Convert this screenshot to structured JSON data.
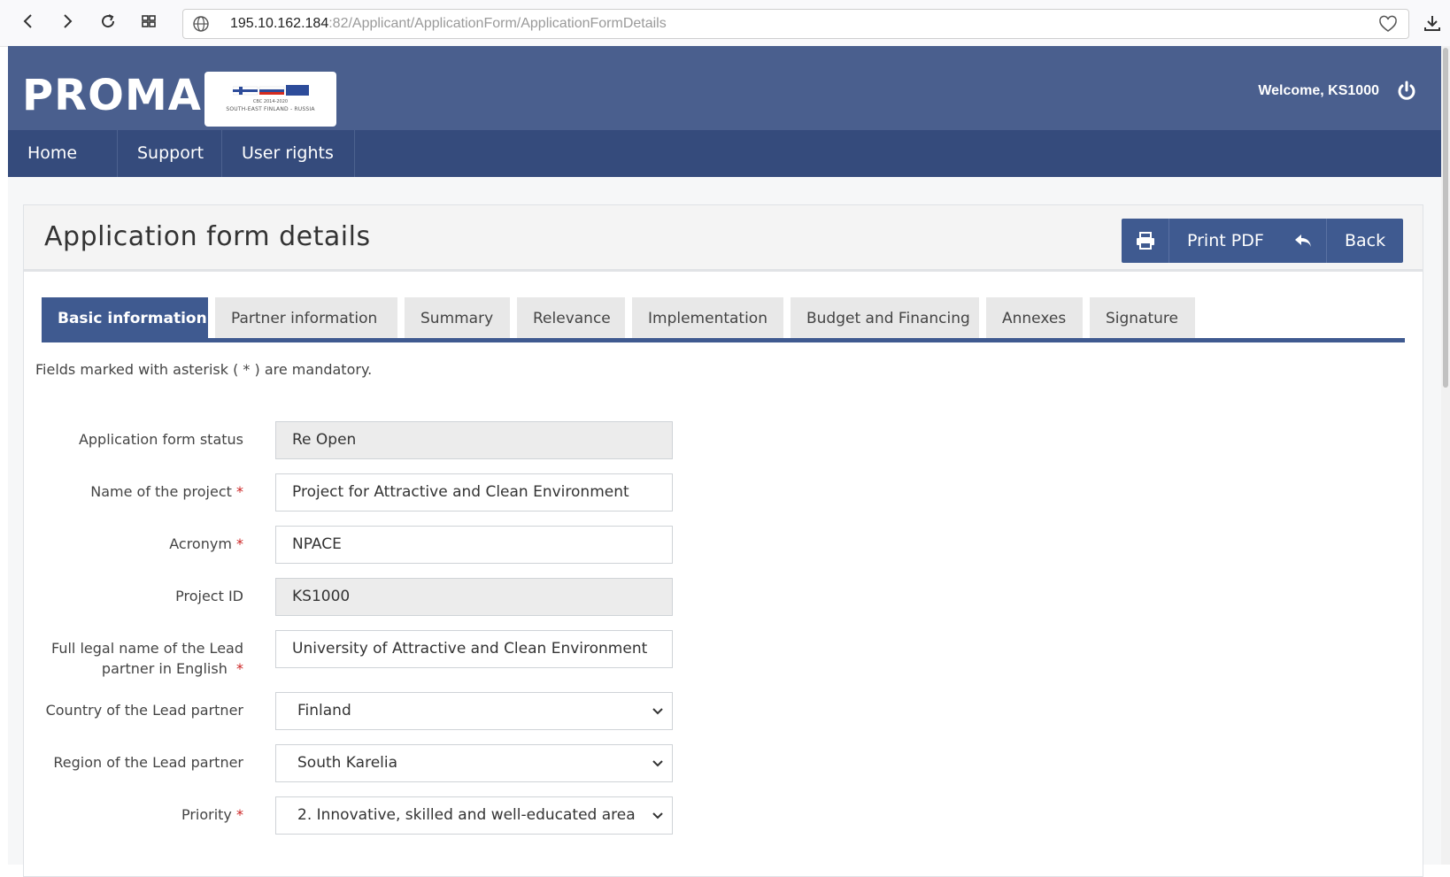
{
  "browser": {
    "url_host": "195.10.162.184",
    "url_path": ":82/Applicant/ApplicationForm/ApplicationFormDetails"
  },
  "header": {
    "brand": "PROMAS",
    "logo_line1": "CBC 2014-2020",
    "logo_line2": "SOUTH-EAST FINLAND - RUSSIA",
    "welcome": "Welcome, KS1000"
  },
  "nav": {
    "items": [
      {
        "label": "Home"
      },
      {
        "label": "Support"
      },
      {
        "label": "User rights"
      }
    ]
  },
  "panel": {
    "title": "Application form details",
    "print_label": "Print PDF",
    "back_label": "Back"
  },
  "tabs": [
    {
      "label": "Basic information",
      "active": true
    },
    {
      "label": "Partner information"
    },
    {
      "label": "Summary"
    },
    {
      "label": "Relevance"
    },
    {
      "label": "Implementation"
    },
    {
      "label": "Budget and Financing"
    },
    {
      "label": "Annexes"
    },
    {
      "label": "Signature"
    }
  ],
  "form": {
    "mandatory_note": "Fields marked with asterisk ( * ) are mandatory.",
    "required_mark": "*",
    "fields": [
      {
        "label": "Application form status",
        "value": "Re Open"
      },
      {
        "label": "Name of the project",
        "value": "Project for Attractive and Clean Environment"
      },
      {
        "label": "Acronym",
        "value": "NPACE"
      },
      {
        "label": "Project ID",
        "value": "KS1000"
      },
      {
        "label_line1": "Full legal name of the Lead",
        "label_line2": "partner in English",
        "value": "University of Attractive and Clean Environment"
      },
      {
        "label": "Country of the Lead partner",
        "value": "Finland"
      },
      {
        "label": "Region of the Lead partner",
        "value": "South Karelia"
      },
      {
        "label": "Priority",
        "value": "2. Innovative, skilled and well-educated area"
      }
    ]
  },
  "colors": {
    "header_bg": "#4a5f8e",
    "nav_bg": "#354b7c",
    "accent": "#3f5a90",
    "required": "#cc2222"
  }
}
